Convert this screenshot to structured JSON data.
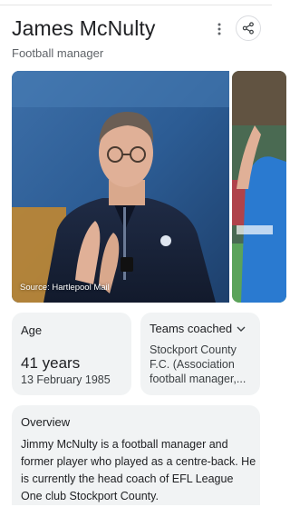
{
  "header": {
    "title": "James McNulty",
    "subtitle": "Football manager"
  },
  "actions": {
    "menu_icon": "more-vert-icon",
    "share_icon": "share-icon"
  },
  "images": {
    "source": "Source: Hartlepool Mail"
  },
  "facts": {
    "age": {
      "label": "Age",
      "value": "41 years",
      "birth_date": "13 February 1985"
    },
    "teams": {
      "label": "Teams coached",
      "value": "Stockport County F.C. (Association football manager,..."
    }
  },
  "overview": {
    "label": "Overview",
    "text": "Jimmy McNulty is a football manager and former player who played as a centre-back. He is currently the head coach of EFL League One club Stockport County."
  }
}
